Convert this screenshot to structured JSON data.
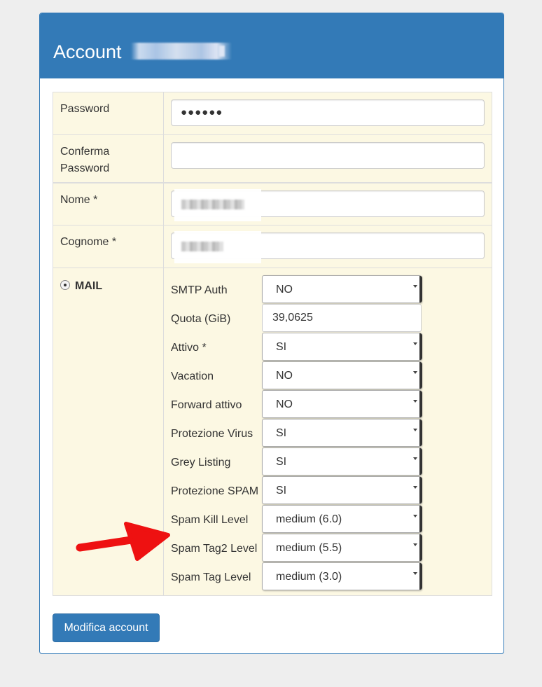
{
  "header": {
    "title": "Account"
  },
  "fields": {
    "password": {
      "label": "Password",
      "value": "●●●●●●"
    },
    "confirm_password": {
      "label_line1": "Conferma",
      "label_line2": "Password",
      "value": ""
    },
    "nome": {
      "label": "Nome *"
    },
    "cognome": {
      "label": "Cognome *"
    }
  },
  "mail": {
    "label": "MAIL",
    "rows": [
      {
        "label": "SMTP Auth",
        "value": "NO",
        "kind": "select"
      },
      {
        "label": "Quota (GiB)",
        "value": "39,0625",
        "kind": "input"
      },
      {
        "label": "Attivo *",
        "value": "SI",
        "kind": "select"
      },
      {
        "label": "Vacation",
        "value": "NO",
        "kind": "select"
      },
      {
        "label": "Forward attivo",
        "value": "NO",
        "kind": "select"
      },
      {
        "label": "Protezione Virus",
        "value": "SI",
        "kind": "select"
      },
      {
        "label": "Grey Listing",
        "value": "SI",
        "kind": "select"
      },
      {
        "label": "Protezione SPAM",
        "value": "SI",
        "kind": "select"
      },
      {
        "label": "Spam Kill Level",
        "value": "medium (6.0)",
        "kind": "select"
      },
      {
        "label": "Spam Tag2 Level",
        "value": "medium (5.5)",
        "kind": "select"
      },
      {
        "label": "Spam Tag Level",
        "value": "medium (3.0)",
        "kind": "select"
      }
    ]
  },
  "actions": {
    "submit_label": "Modifica account"
  },
  "colors": {
    "primary": "#337ab7",
    "row_bg": "#fcf8e3",
    "arrow": "#ee1111"
  }
}
